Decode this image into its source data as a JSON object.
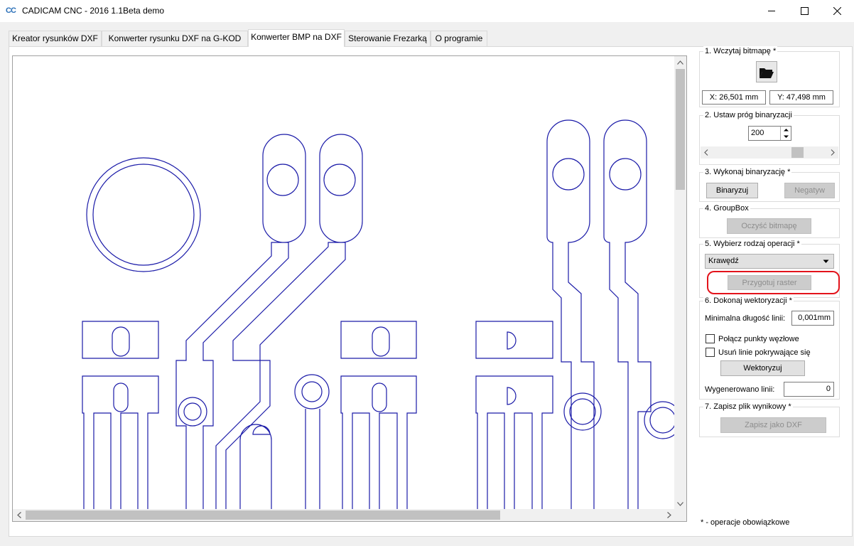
{
  "window": {
    "title": "CADICAM CNC - 2016 1.1Beta demo",
    "icon_text": "CC",
    "controls": [
      "minimize-icon",
      "maximize-icon",
      "close-icon"
    ]
  },
  "tabs": [
    {
      "label": "Kreator rysunków DXF",
      "active": false
    },
    {
      "label": "Konwerter rysunku DXF na G-KOD",
      "active": false
    },
    {
      "label": "Konwerter BMP na DXF",
      "active": true
    },
    {
      "label": "Sterowanie Frezarką",
      "active": false
    },
    {
      "label": "O programie",
      "active": false
    }
  ],
  "canvas": {
    "stroke_color": "#1a1aa8",
    "scroll_icons": [
      "chevron-up-icon",
      "chevron-down-icon",
      "chevron-left-icon",
      "chevron-right-icon"
    ]
  },
  "panel": {
    "load": {
      "title": "1. Wczytaj bitmapę *",
      "icon": "folder-open-icon",
      "x_readout": "X: 26,501 mm",
      "y_readout": "Y: 47,498 mm"
    },
    "threshold": {
      "title": "2. Ustaw próg binaryzacji",
      "value": "200",
      "slider_level": 0.78
    },
    "binarize": {
      "title": "3. Wykonaj binaryzację *",
      "binarize_button": "Binaryzuj",
      "negative_button": "Negatyw"
    },
    "clear": {
      "title": "4. GroupBox",
      "clear_button": "Oczyść bitmapę"
    },
    "operation": {
      "title": "5. Wybierz rodzaj operacji *",
      "selected": "Krawędź",
      "prepare_button": "Przygotuj raster"
    },
    "vectorize": {
      "title": "6. Dokonaj wektoryzacji *",
      "min_length_label": "Minimalna długość linii:",
      "min_length_value": "0,001mm",
      "join_nodes_label": "Połącz punkty węzłowe",
      "remove_overlap_label": "Usuń linie pokrywające się",
      "vectorize_button": "Wektoryzuj",
      "generated_label": "Wygenerowano linii:",
      "generated_value": "0"
    },
    "save": {
      "title": "7. Zapisz plik wynikowy *",
      "save_button": "Zapisz jako DXF"
    },
    "footnote": "* - operacje obowiązkowe"
  },
  "highlight_color": "#e3131b"
}
